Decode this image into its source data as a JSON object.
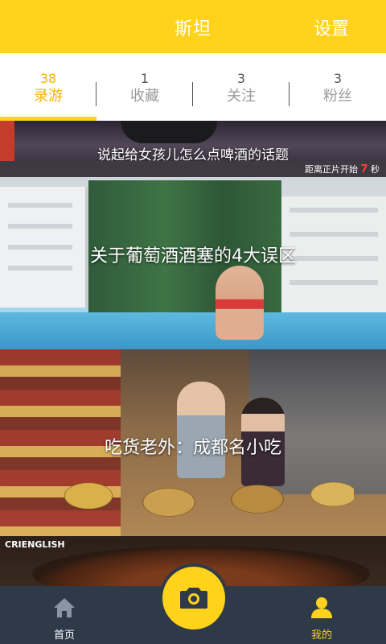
{
  "header": {
    "title": "斯坦",
    "settings_label": "设置"
  },
  "tabs": [
    {
      "count": "38",
      "label": "录游",
      "active": true
    },
    {
      "count": "1",
      "label": "收藏",
      "active": false
    },
    {
      "count": "3",
      "label": "关注",
      "active": false
    },
    {
      "count": "3",
      "label": "粉丝",
      "active": false
    }
  ],
  "feed": {
    "cards": [
      {
        "caption": "说起给女孩儿怎么点啤酒的话题",
        "overlay_text": "距离正片开始",
        "countdown": "7",
        "countdown_unit": "秒"
      },
      {
        "caption": "关于葡萄酒酒塞的4大误区"
      },
      {
        "caption": "吃货老外：成都名小吃"
      },
      {
        "watermark": "CRIENGLISH"
      }
    ]
  },
  "bottom_nav": {
    "home_label": "首页",
    "me_label": "我的",
    "camera_icon": "camera-icon"
  },
  "colors": {
    "accent": "#ffd21c",
    "active_text": "#f2b400",
    "nav_bg": "#2f3a48"
  }
}
